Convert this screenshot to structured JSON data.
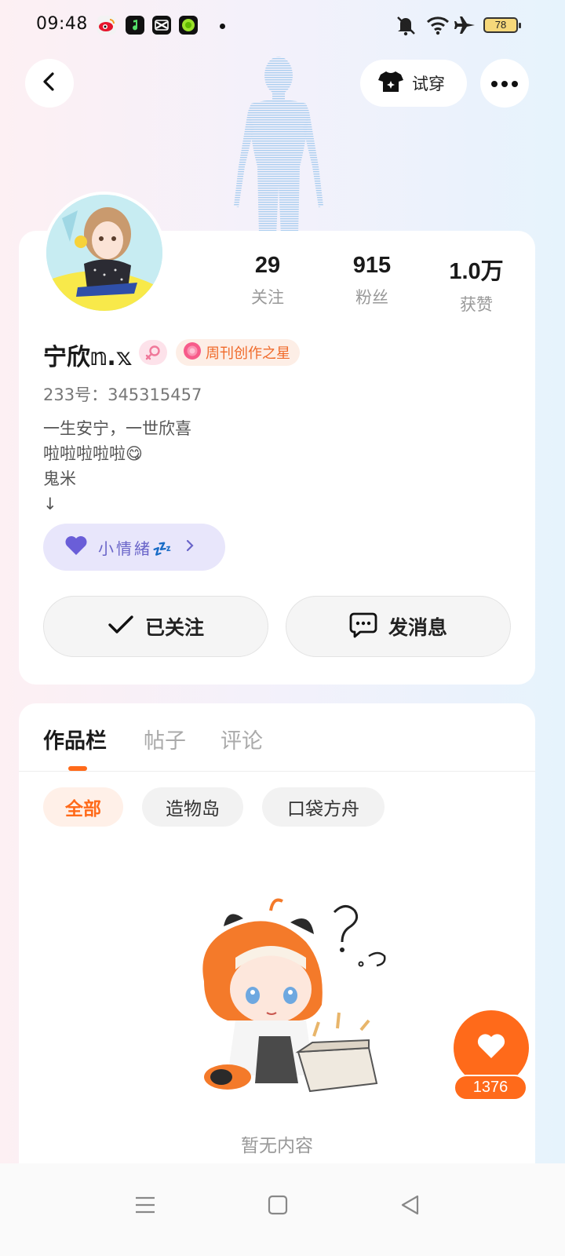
{
  "status_bar": {
    "time": "09:48",
    "battery": "78",
    "app_icons": [
      "weibo-icon",
      "music-icon",
      "capcut-icon",
      "green-app-icon"
    ],
    "system_icons": [
      "mute-icon",
      "wifi-icon",
      "airplane-icon",
      "battery-icon"
    ]
  },
  "header": {
    "back_icon": "chevron-left-icon",
    "tryon_label": "试穿",
    "tryon_icon": "shirt-icon",
    "more_icon": "more-dots-icon"
  },
  "profile": {
    "stats": [
      {
        "value": "29",
        "label": "关注"
      },
      {
        "value": "915",
        "label": "粉丝"
      },
      {
        "value": "1.0万",
        "label": "获赞"
      }
    ],
    "username": "宁欣𝕟.𝕩",
    "gender_icon": "female-icon",
    "badge_label": "周刊创作之星",
    "uid": "233号：345315457",
    "bio": "一生安宁，一世欣喜\n啦啦啦啦啦😋\n鬼米\n  ↓",
    "mood_label": "小情緒💤",
    "follow_label": "已关注",
    "message_label": "发消息"
  },
  "works": {
    "tabs": [
      "作品栏",
      "帖子",
      "评论"
    ],
    "active_tab": "作品栏",
    "filters": [
      "全部",
      "造物岛",
      "口袋方舟"
    ],
    "active_filter": "全部",
    "empty_text": "暂无内容"
  },
  "like_fab": {
    "count": "1376"
  },
  "nav": {
    "icons": [
      "menu-icon",
      "home-square-icon",
      "back-triangle-icon"
    ]
  },
  "colors": {
    "accent": "#ff6a1a",
    "mood_purple": "#6a65c9",
    "badge_orange": "#f06a2a"
  }
}
